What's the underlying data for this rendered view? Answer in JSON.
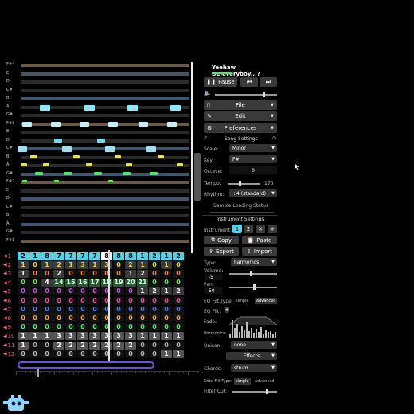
{
  "song_title": "Yeehaw Deleveryboy...?",
  "playback": {
    "pause_label": "Pause"
  },
  "menus": {
    "file": "File",
    "edit": "Edit",
    "preferences": "Preferences"
  },
  "song_settings": {
    "header": "Song Settings",
    "scale_label": "Scale:",
    "scale_value": "Minor",
    "key_label": "Key:",
    "key_value": "F#",
    "octave_label": "Octave:",
    "octave_value": "0",
    "tempo_label": "Tempo:",
    "tempo_value": "170",
    "rhythm_label": "Rhythm:",
    "rhythm_value": "÷4 (standard)",
    "sample_loading": "Sample Loading Status"
  },
  "instrument_settings": {
    "header": "Instrument Settings",
    "instrument_label": "Instrument:",
    "instrument_tabs": [
      "1",
      "2"
    ],
    "copy": "Copy",
    "paste": "Paste",
    "export": "Export",
    "import": "Import",
    "type_label": "Type:",
    "type_value": "harmonics",
    "volume_label": "Volume:",
    "volume_value": "-5",
    "pan_label": "Pan:",
    "pan_value": "50",
    "eq_filt_type_label": "EQ Filt.Type:",
    "eq_simple": "simple",
    "eq_advanced": "advanced",
    "eq_filt_label": "EQ Filt:",
    "fade_label": "Fade:",
    "harmonics_label": "Harmonics:",
    "unison_label": "Unison:",
    "unison_value": "none",
    "effects_label": "Effects",
    "chords_label": "Chords:",
    "chords_value": "strum",
    "note_filt_type_label": "Note Filt.Type:",
    "note_simple": "simple",
    "note_advanced": "advanced",
    "filter_cut_label": "Filter Cut:"
  },
  "note_labels": [
    "F#4",
    "E",
    "D",
    "C#",
    "B",
    "A",
    "G#",
    "F#3",
    "E",
    "D",
    "C#",
    "B",
    "A",
    "G#",
    "F#2",
    "E",
    "D",
    "C#",
    "B",
    "A",
    "G#",
    "F#1"
  ],
  "tracks": [
    {
      "num": "1",
      "color": "#4fd3e8",
      "cells": [
        "2",
        "1",
        "8",
        "7",
        "7",
        "7",
        "7",
        "8",
        "8",
        "8",
        "1",
        "2",
        "1",
        "2"
      ]
    },
    {
      "num": "2",
      "color": "#e8d44f",
      "cells": [
        "1",
        "0",
        "1",
        "2",
        "1",
        "3",
        "1",
        "3",
        "0",
        "2",
        "1",
        "0",
        "1",
        "0"
      ]
    },
    {
      "num": "3",
      "color": "#e8784f",
      "cells": [
        "1",
        "0",
        "0",
        "2",
        "0",
        "0",
        "0",
        "0",
        "0",
        "1",
        "2",
        "0",
        "0",
        "0"
      ]
    },
    {
      "num": "4",
      "color": "#6de84f",
      "cells": [
        "0",
        "0",
        "4",
        "14",
        "15",
        "16",
        "17",
        "18",
        "19",
        "20",
        "21",
        "0",
        "0",
        "0"
      ]
    },
    {
      "num": "5",
      "color": "#c84fe8",
      "cells": [
        "0",
        "0",
        "0",
        "0",
        "0",
        "0",
        "0",
        "0",
        "0",
        "0",
        "1",
        "2",
        "1",
        "2"
      ]
    },
    {
      "num": "6",
      "color": "#e84f9b",
      "cells": [
        "0",
        "0",
        "0",
        "0",
        "0",
        "0",
        "0",
        "0",
        "0",
        "0",
        "0",
        "0",
        "0",
        "0"
      ]
    },
    {
      "num": "7",
      "color": "#4f7be8",
      "cells": [
        "0",
        "0",
        "0",
        "0",
        "0",
        "0",
        "0",
        "0",
        "0",
        "0",
        "0",
        "0",
        "0",
        "0"
      ]
    },
    {
      "num": "8",
      "color": "#e8a04f",
      "cells": [
        "0",
        "0",
        "0",
        "0",
        "0",
        "0",
        "0",
        "0",
        "0",
        "0",
        "0",
        "0",
        "0",
        "0"
      ]
    },
    {
      "num": "9",
      "color": "#4fe87b",
      "cells": [
        "0",
        "0",
        "0",
        "0",
        "0",
        "0",
        "0",
        "0",
        "0",
        "0",
        "0",
        "0",
        "0",
        "0"
      ]
    },
    {
      "num": "10",
      "color": "#cccccc",
      "cells": [
        "1",
        "1",
        "1",
        "3",
        "3",
        "3",
        "3",
        "3",
        "3",
        "3",
        "1",
        "1",
        "1",
        "1"
      ]
    },
    {
      "num": "11",
      "color": "#aaaaaa",
      "cells": [
        "1",
        "0",
        "0",
        "2",
        "2",
        "2",
        "2",
        "2",
        "2",
        "2",
        "0",
        "0",
        "0",
        "0"
      ]
    },
    {
      "num": "12",
      "color": "#bbbbbb",
      "cells": [
        "0",
        "0",
        "0",
        "0",
        "0",
        "0",
        "0",
        "0",
        "0",
        "0",
        "0",
        "0",
        "1",
        "1"
      ]
    }
  ],
  "colors": {
    "accent": "#4fd3e8",
    "loop": "#6a4fe8"
  }
}
